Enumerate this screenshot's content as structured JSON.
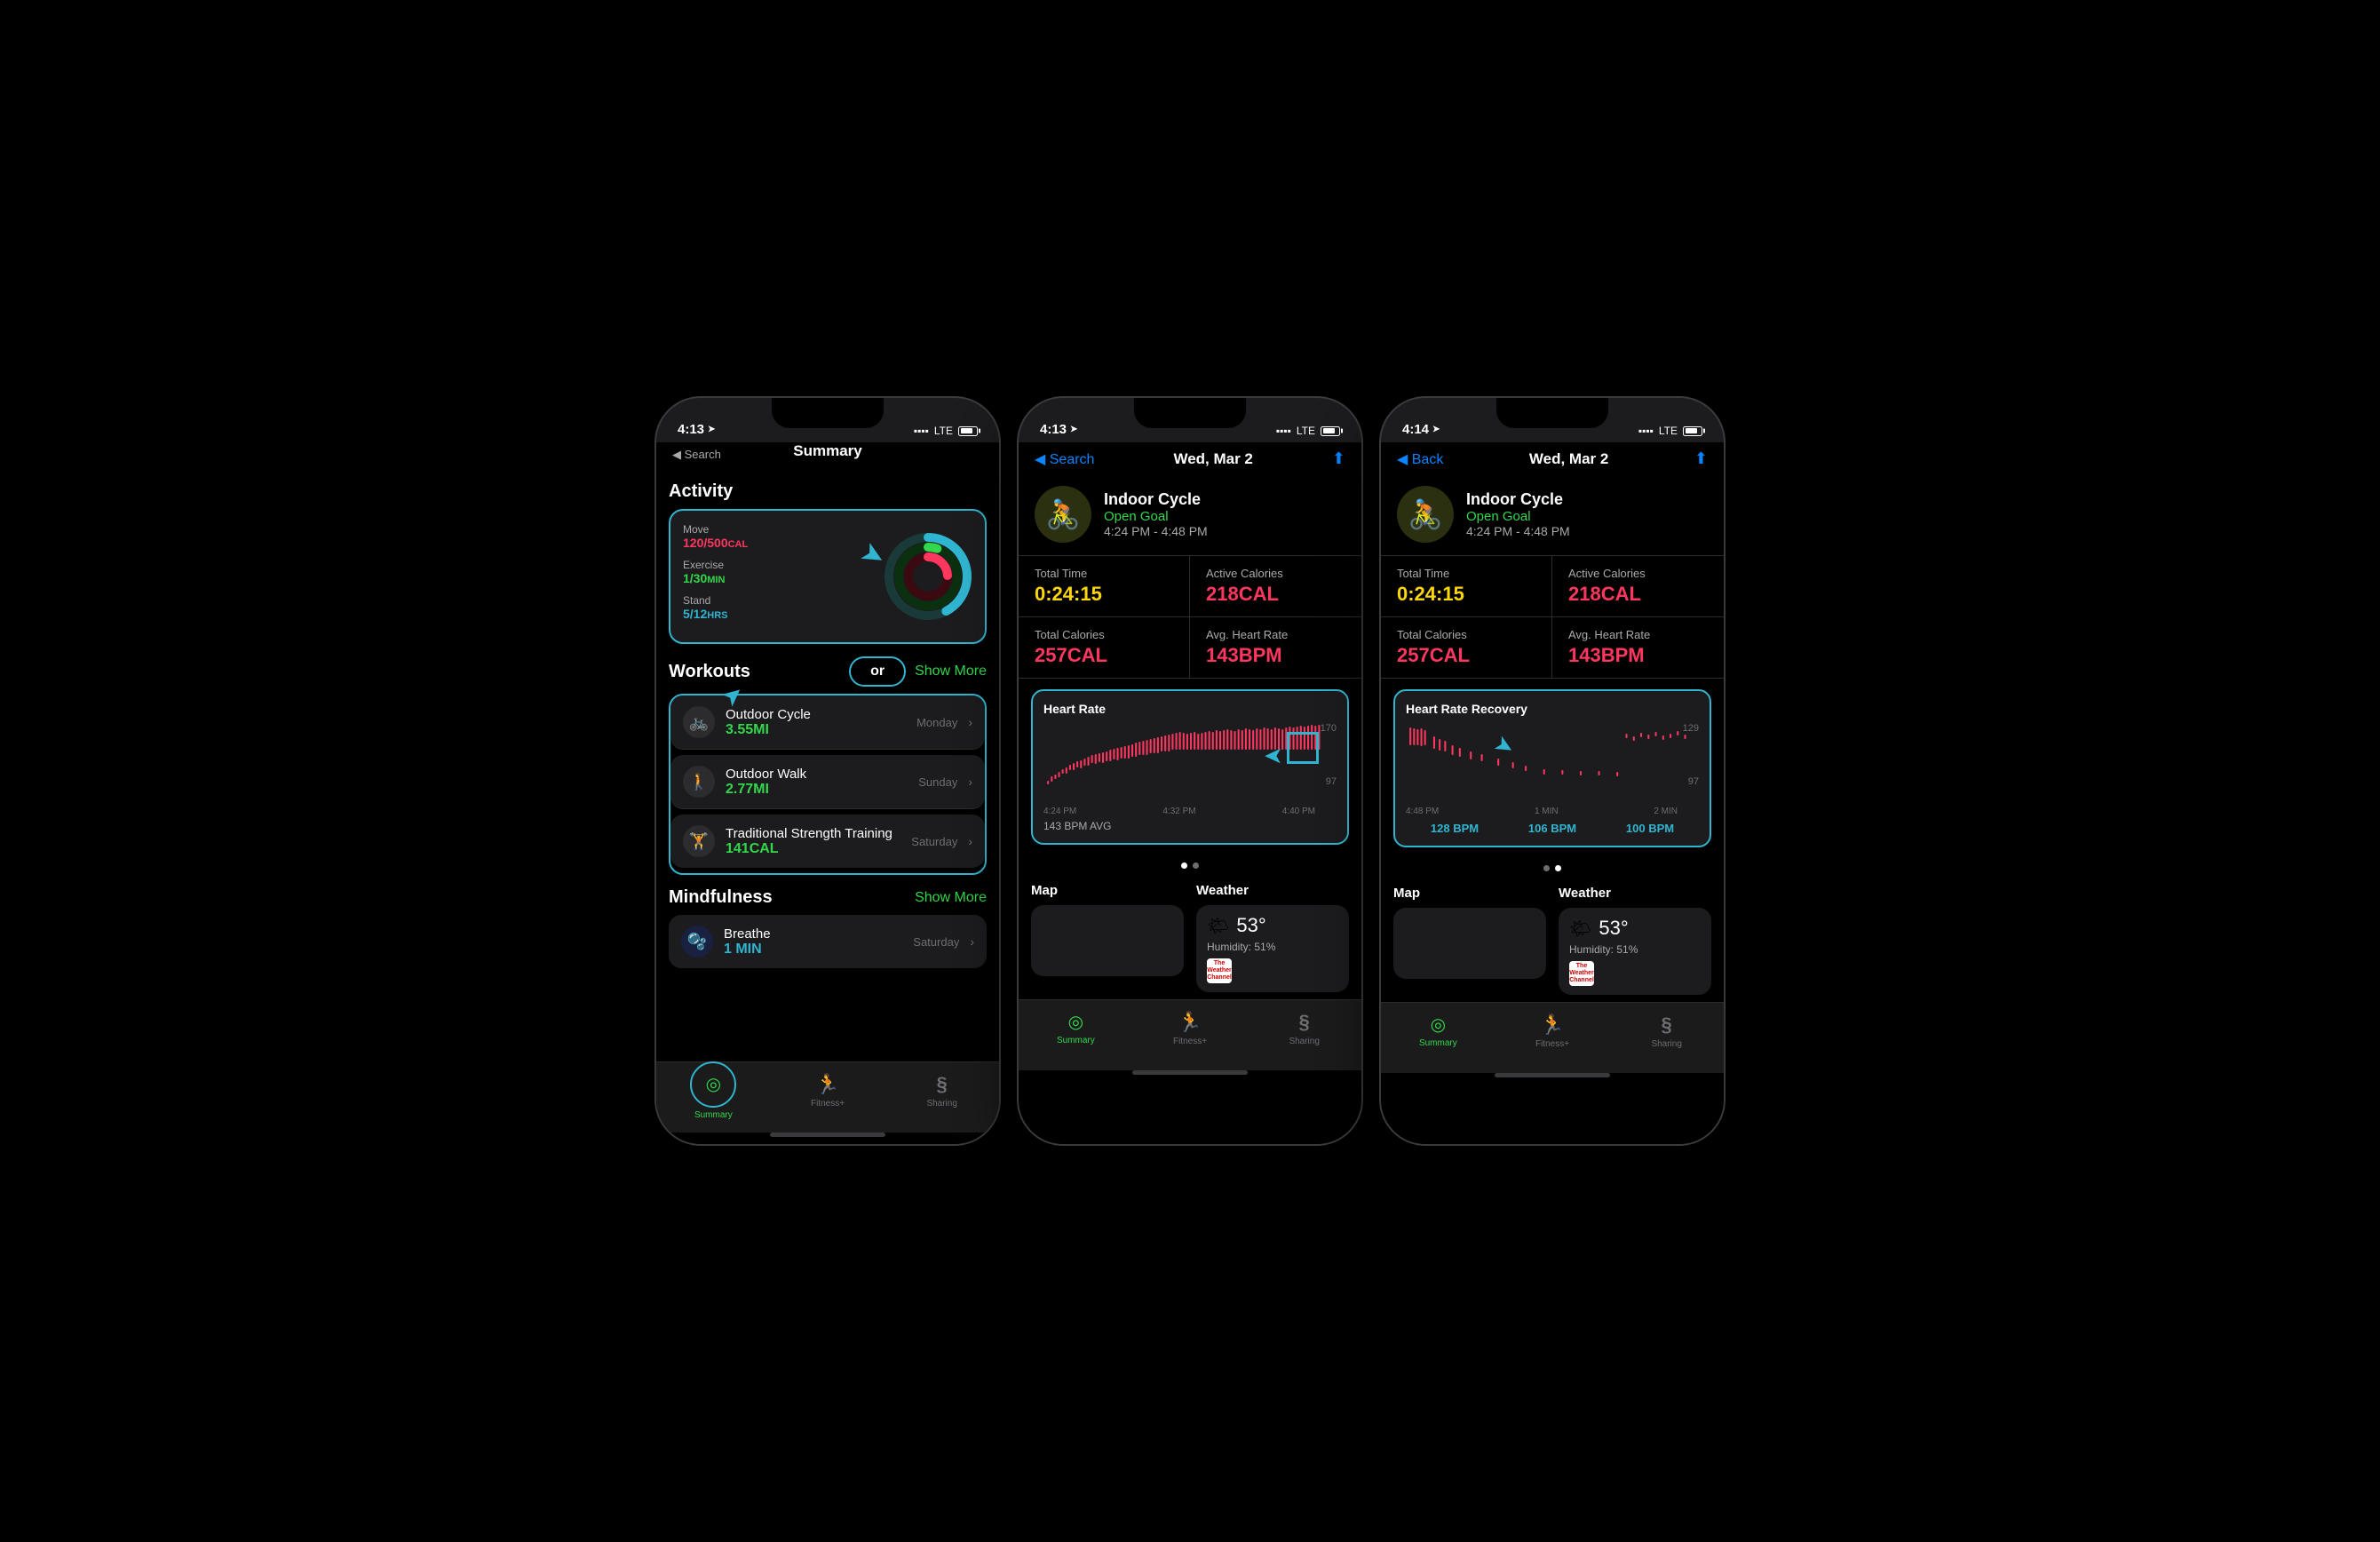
{
  "phones": [
    {
      "id": "summary",
      "statusBar": {
        "time": "4:13",
        "hasArrow": true,
        "signal": "●●●●",
        "networkType": "LTE",
        "hasBattery": true
      },
      "navTitle": "Summary",
      "isDetailPage": false,
      "activity": {
        "sectionLabel": "Activity",
        "move": {
          "label": "Move",
          "value": "120/500",
          "unit": "CAL",
          "colorClass": "red"
        },
        "exercise": {
          "label": "Exercise",
          "value": "1/30",
          "unit": "MIN",
          "colorClass": "green"
        },
        "stand": {
          "label": "Stand",
          "value": "5/12",
          "unit": "HRS",
          "colorClass": "blue"
        },
        "ring": {
          "movePercent": 24,
          "exercisePercent": 5,
          "standPercent": 42
        }
      },
      "workouts": {
        "sectionLabel": "Workouts",
        "showMoreLabel": "Show More",
        "orLabel": "or",
        "items": [
          {
            "icon": "🚲",
            "name": "Outdoor Cycle",
            "value": "3.55MI",
            "day": "Monday"
          },
          {
            "icon": "🚶",
            "name": "Outdoor Walk",
            "value": "2.77MI",
            "day": "Sunday"
          },
          {
            "icon": "🏋️",
            "name": "Traditional Strength Training",
            "value": "141CAL",
            "day": "Saturday"
          }
        ]
      },
      "mindfulness": {
        "sectionLabel": "Mindfulness",
        "showMoreLabel": "Show More",
        "items": [
          {
            "icon": "🫧",
            "name": "Breathe",
            "value": "1 MIN",
            "day": "Saturday"
          }
        ]
      },
      "tabBar": {
        "tabs": [
          {
            "label": "Summary",
            "active": true
          },
          {
            "label": "Fitness+",
            "active": false
          },
          {
            "label": "Sharing",
            "active": false
          }
        ]
      }
    },
    {
      "id": "detail-heart-rate",
      "statusBar": {
        "time": "4:13",
        "hasArrow": true,
        "signal": "●●●●",
        "networkType": "LTE",
        "hasBattery": true
      },
      "navBackLabel": "Search",
      "navTitle": "Wed, Mar 2",
      "isDetailPage": true,
      "workout": {
        "icon": "🚴",
        "type": "Indoor Cycle",
        "goal": "Open Goal",
        "timeRange": "4:24 PM - 4:48 PM"
      },
      "stats": [
        {
          "label": "Total Time",
          "value": "0:24:15",
          "colorClass": "yellow"
        },
        {
          "label": "Active Calories",
          "value": "218CAL",
          "colorClass": "red"
        },
        {
          "label": "Total Calories",
          "value": "257CAL",
          "colorClass": "red"
        },
        {
          "label": "Avg. Heart Rate",
          "value": "143BPM",
          "colorClass": "red"
        }
      ],
      "chart": {
        "label": "Heart Rate",
        "yMax": "170",
        "yMin": "97",
        "xLabels": [
          "4:24 PM",
          "4:32 PM",
          "4:40 PM"
        ],
        "avgLabel": "143 BPM AVG",
        "type": "heart-rate"
      },
      "weather": {
        "sectionLabel": "Weather",
        "temp": "53°",
        "humidity": "Humidity: 51%"
      },
      "tabBar": {
        "tabs": [
          {
            "label": "Summary",
            "active": true
          },
          {
            "label": "Fitness+",
            "active": false
          },
          {
            "label": "Sharing",
            "active": false
          }
        ]
      }
    },
    {
      "id": "detail-heart-rate-recovery",
      "statusBar": {
        "time": "4:14",
        "hasArrow": true,
        "signal": "●●●●",
        "networkType": "LTE",
        "hasBattery": true
      },
      "navBackLabel": "Back",
      "navTitle": "Wed, Mar 2",
      "isDetailPage": true,
      "workout": {
        "icon": "🚴",
        "type": "Indoor Cycle",
        "goal": "Open Goal",
        "timeRange": "4:24 PM - 4:48 PM"
      },
      "stats": [
        {
          "label": "Total Time",
          "value": "0:24:15",
          "colorClass": "yellow"
        },
        {
          "label": "Active Calories",
          "value": "218CAL",
          "colorClass": "red"
        },
        {
          "label": "Total Calories",
          "value": "257CAL",
          "colorClass": "red"
        },
        {
          "label": "Avg. Heart Rate",
          "value": "143BPM",
          "colorClass": "red"
        }
      ],
      "chart": {
        "label": "Heart Rate Recovery",
        "yMax": "129",
        "yMin": "97",
        "xLabels": [
          "4:48 PM",
          "1 MIN",
          "2 MIN"
        ],
        "recoveryValues": [
          "128 BPM",
          "106 BPM",
          "100 BPM"
        ],
        "type": "recovery"
      },
      "weather": {
        "sectionLabel": "Weather",
        "temp": "53°",
        "humidity": "Humidity: 51%"
      },
      "tabBar": {
        "tabs": [
          {
            "label": "Summary",
            "active": true
          },
          {
            "label": "Fitness+",
            "active": false
          },
          {
            "label": "Sharing",
            "active": false
          }
        ]
      }
    }
  ],
  "icons": {
    "summary_tab": "◎",
    "fitness_tab": "🏃",
    "sharing_tab": "S",
    "chevron_right": "›",
    "chevron_left": "‹",
    "share": "⬆"
  }
}
